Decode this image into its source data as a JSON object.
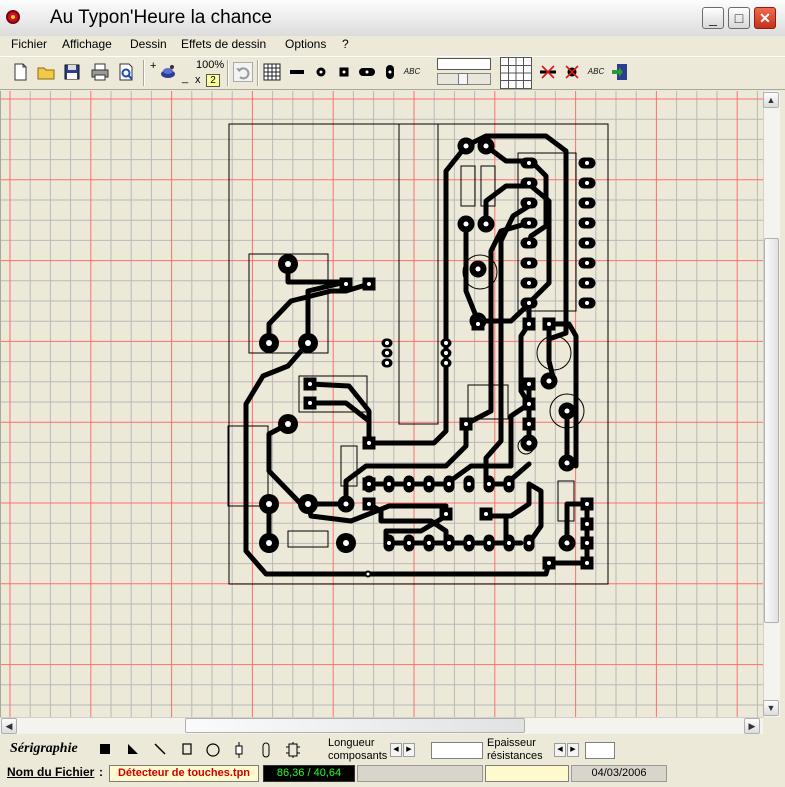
{
  "window": {
    "title": "Au Typon'Heure la chance",
    "minimize": "_",
    "maximize": "□",
    "close": "✕"
  },
  "menu": [
    "Fichier",
    "Affichage",
    "Dessin",
    "Effets de dessin",
    "Options",
    "?"
  ],
  "toolbar": {
    "zoom": "100%",
    "zoom_factor": "2",
    "zoom_x": "x",
    "text_tool_label": "ABC",
    "text_tool2_label": "ABC",
    "plus": "+",
    "minus": "_"
  },
  "bottom": {
    "serigraphie_label": "Sérigraphie",
    "longueur_label": "Longueur",
    "composants_label": "composants",
    "epaisseur_label": "Epaisseur",
    "resistances_label": "résistances",
    "filename_label": "Nom du Fichier",
    "filename_colon": ":",
    "filename_value": "Détecteur de touches.tpn",
    "coords_value": "86,36 / 40,64",
    "date_value": "04/03/2006"
  },
  "colors": {
    "grid_major": "#ff6f6f",
    "grid_minor": "#b9b9b9",
    "trace": "#000000",
    "filename_text": "#cc0000",
    "coords_bg": "#000000",
    "coords_text": "#22ff22",
    "status_yellow": "#fffacd"
  }
}
